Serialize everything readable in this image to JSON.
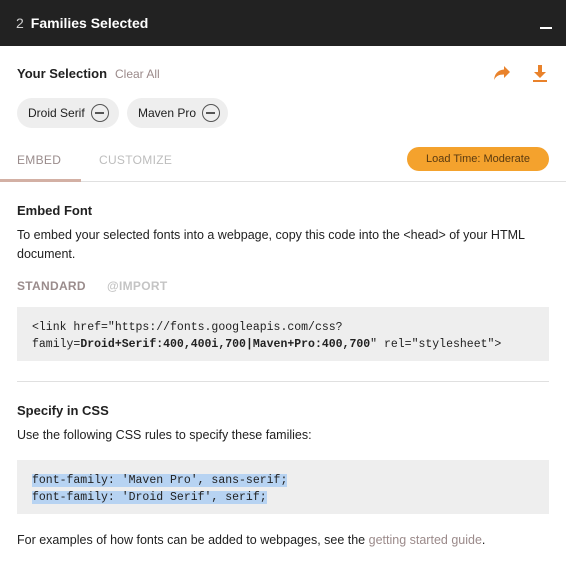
{
  "header": {
    "count": "2",
    "title": "Families Selected"
  },
  "selection": {
    "title": "Your Selection",
    "clear_all": "Clear All",
    "chips": [
      {
        "label": "Droid Serif"
      },
      {
        "label": "Maven Pro"
      }
    ]
  },
  "tabs": {
    "embed": "EMBED",
    "customize": "CUSTOMIZE",
    "load_time": "Load Time: Moderate"
  },
  "embed_font": {
    "title": "Embed Font",
    "description": "To embed your selected fonts into a webpage, copy this code into the <head> of your HTML document.",
    "standard": "STANDARD",
    "import": "@IMPORT",
    "code_prefix": "<link href=\"https://fonts.googleapis.com/css?family=",
    "code_bold": "Droid+Serif:400,400i,700|Maven+Pro:400,700",
    "code_suffix": "\" rel=\"stylesheet\">"
  },
  "specify_css": {
    "title": "Specify in CSS",
    "description": "Use the following CSS rules to specify these families:",
    "rule_1": "font-family: 'Maven Pro', sans-serif;",
    "rule_2": "font-family: 'Droid Serif', serif;"
  },
  "footer": {
    "text": "For examples of how fonts can be added to webpages, see the ",
    "link": "getting started guide",
    "end": "."
  },
  "colors": {
    "header_bg": "#222222",
    "accent": "#f4a22d",
    "link": "#9b8a8a"
  },
  "icons": {
    "share": "share-icon",
    "download": "download-icon",
    "remove": "remove-icon",
    "minimize": "minimize-icon"
  }
}
